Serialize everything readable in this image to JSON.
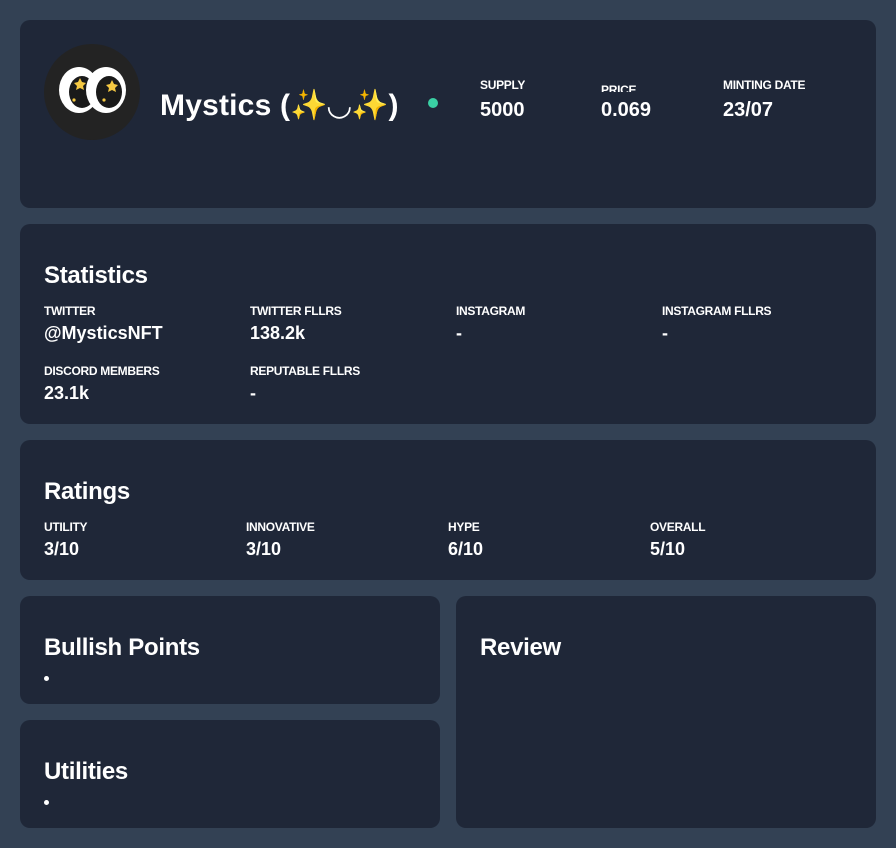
{
  "header": {
    "name": "Mystics (✨◡✨)",
    "avatar": "mystics-eyes-logo",
    "status_color": "#3ad0a4",
    "stats": [
      {
        "label": "SUPPLY",
        "value": "5000"
      },
      {
        "label": "PRICE",
        "value": "0.069"
      },
      {
        "label": "MINTING DATE",
        "value": "23/07"
      }
    ]
  },
  "statistics": {
    "title": "Statistics",
    "items": [
      {
        "label": "TWITTER",
        "value": "@MysticsNFT"
      },
      {
        "label": "TWITTER FLLRS",
        "value": "138.2k"
      },
      {
        "label": "INSTAGRAM",
        "value": "-"
      },
      {
        "label": "INSTAGRAM FLLRS",
        "value": "-"
      },
      {
        "label": "DISCORD MEMBERS",
        "value": "23.1k"
      },
      {
        "label": "REPUTABLE FLLRS",
        "value": "-"
      }
    ]
  },
  "ratings": {
    "title": "Ratings",
    "items": [
      {
        "label": "UTILITY",
        "value": "3/10"
      },
      {
        "label": "INNOVATIVE",
        "value": "3/10"
      },
      {
        "label": "HYPE",
        "value": "6/10"
      },
      {
        "label": "OVERALL",
        "value": "5/10"
      }
    ]
  },
  "bullish_points": {
    "title": "Bullish Points",
    "items": [
      ""
    ]
  },
  "utilities": {
    "title": "Utilities",
    "items": [
      ""
    ]
  },
  "review": {
    "title": "Review",
    "text": ""
  },
  "colors": {
    "background": "#334154",
    "card": "#1f2738",
    "text": "#ffffff"
  }
}
